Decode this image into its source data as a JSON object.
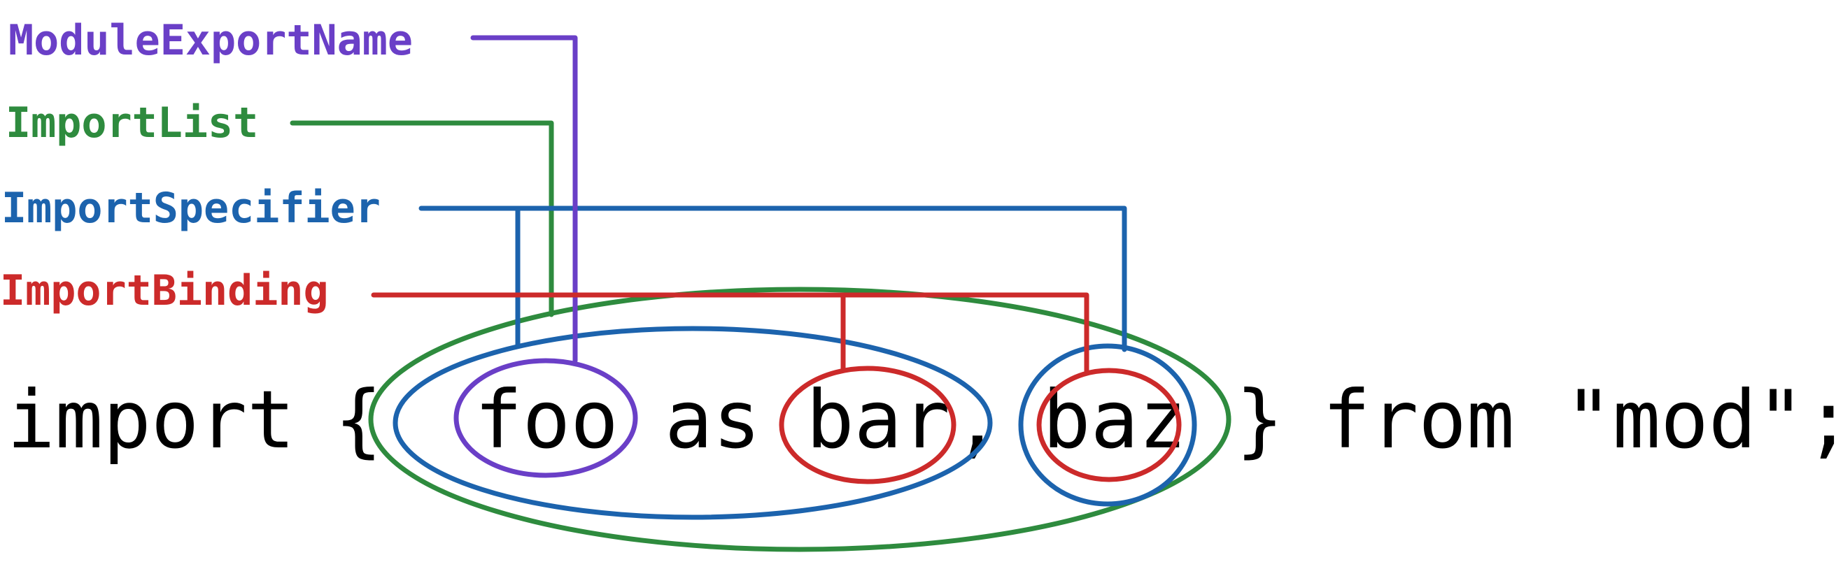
{
  "colors": {
    "ModuleExportName": "#6a3fc7",
    "ImportList": "#2e8b3e",
    "ImportSpecifier": "#1c63ad",
    "ImportBinding": "#cc2a2a",
    "code": "#000000"
  },
  "labels": {
    "module_export_name": "ModuleExportName",
    "import_list": "ImportList",
    "import_specifier": "ImportSpecifier",
    "import_binding": "ImportBinding"
  },
  "code": {
    "kw_import": "import",
    "lbrace": "{",
    "foo": "foo",
    "kw_as": "as",
    "bar": "bar",
    "comma": ",",
    "baz": "baz",
    "rbrace": "}",
    "kw_from": "from",
    "module": "\"mod\";"
  }
}
